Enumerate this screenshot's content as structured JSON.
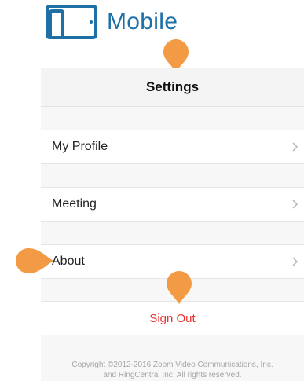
{
  "brand": {
    "name": "Mobile"
  },
  "header": {
    "title": "Settings"
  },
  "menu": [
    {
      "label": "My Profile"
    },
    {
      "label": "Meeting"
    },
    {
      "label": "About"
    }
  ],
  "sign_out": {
    "label": "Sign Out"
  },
  "footer": {
    "line1": "Copyright ©2012-2016 Zoom Video Communications, Inc.",
    "line2": "and RingCentral Inc. All rights reserved."
  },
  "colors": {
    "brand": "#1d6fa5",
    "sign_out": "#e5322d",
    "annotation": "#f39a44"
  },
  "icons": {
    "logo": "tablet-phone-icon",
    "chevron": "chevron-right-icon",
    "marker": "annotation-pin-icon"
  }
}
